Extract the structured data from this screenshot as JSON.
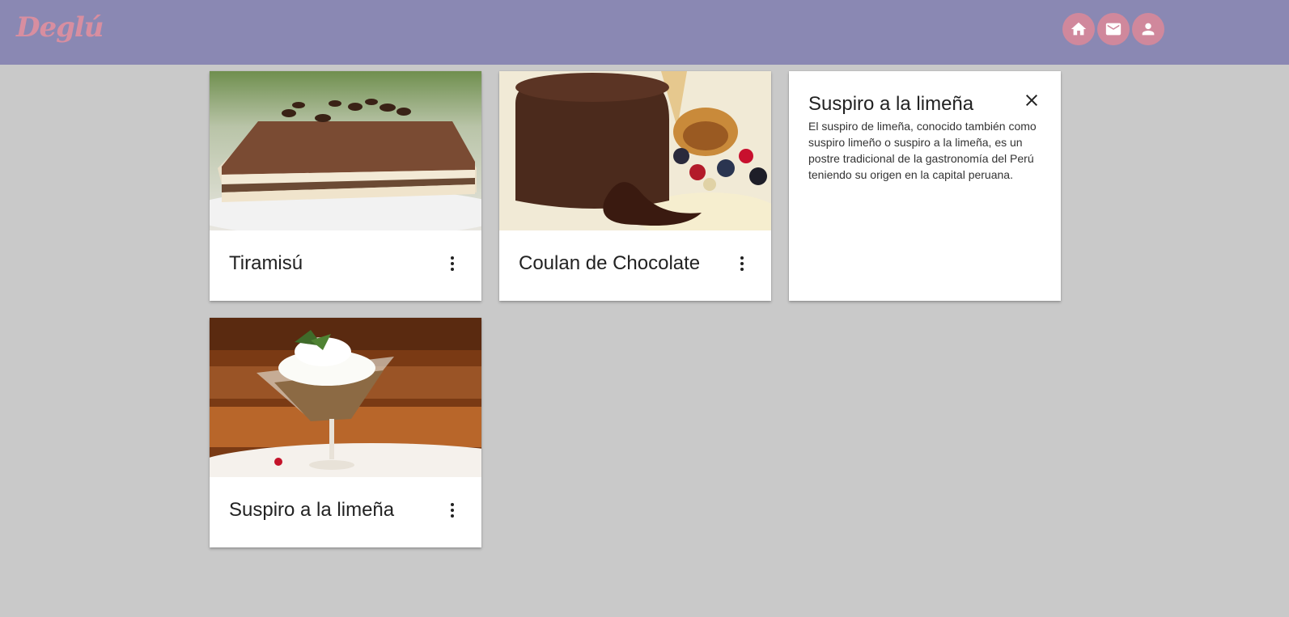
{
  "header": {
    "logo": "Deglú",
    "nav": [
      {
        "icon": "home-icon"
      },
      {
        "icon": "mail-icon"
      },
      {
        "icon": "user-icon"
      }
    ]
  },
  "colors": {
    "navbar": "#8a88b3",
    "accent": "#d0889c",
    "background": "#c9c9c9"
  },
  "cards": [
    {
      "title": "Tiramisú",
      "image": "tiramisu-image"
    },
    {
      "title": "Coulan de Chocolate",
      "image": "chocolate-coulant-image"
    },
    {
      "reveal": true,
      "title": "Suspiro a la limeña",
      "description": "El suspiro de limeña, conocido también como suspiro limeño o suspiro a la limeña, es un postre tradicional de la gastronomía del Perú teniendo su origen en la capital peruana."
    },
    {
      "title": "Suspiro a la limeña",
      "image": "suspiro-image"
    }
  ]
}
